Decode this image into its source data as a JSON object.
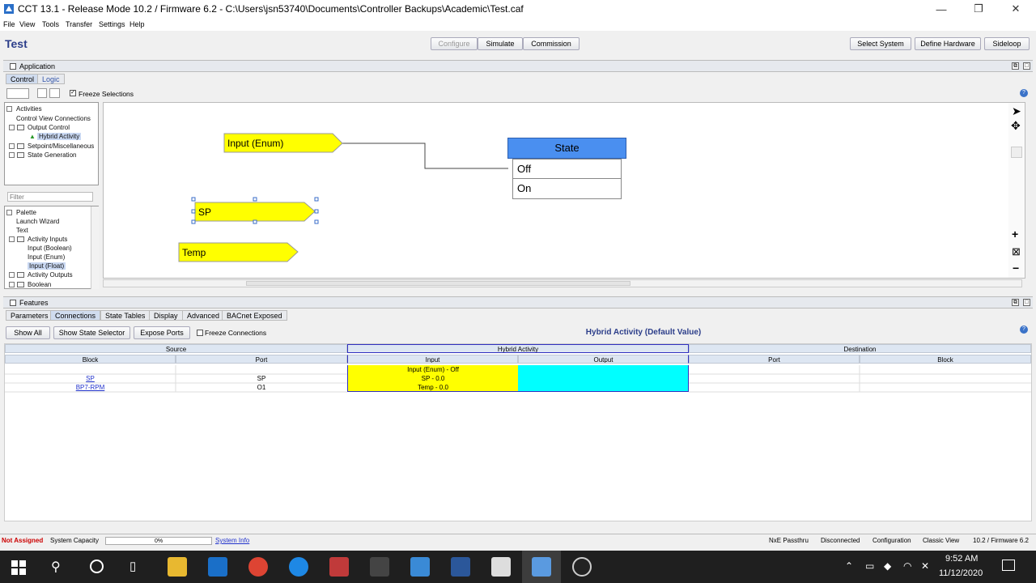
{
  "window": {
    "title": "CCT 13.1 - Release Mode 10.2 / Firmware 6.2 - C:\\Users\\jsn53740\\Documents\\Controller Backups\\Academic\\Test.caf"
  },
  "menu": [
    "File",
    "View",
    "Tools",
    "Transfer",
    "Settings",
    "Help"
  ],
  "header": {
    "title": "Test",
    "mode_buttons": [
      "Configure",
      "Simulate",
      "Commission"
    ],
    "right_buttons": [
      "Select System",
      "Define Hardware",
      "Sideloop"
    ]
  },
  "application": {
    "panel_title": "Application",
    "tabs": [
      "Control",
      "Logic"
    ],
    "freeze_label": "Freeze Selections",
    "tree": [
      "Activities",
      "Control View Connections",
      "Output Control",
      "Hybrid Activity",
      "Setpoint/Miscellaneous",
      "State Generation"
    ],
    "filter_placeholder": "Filter",
    "palette": [
      "Palette",
      "Launch Wizard",
      "Text",
      "Activity Inputs",
      "Input (Boolean)",
      "Input (Enum)",
      "Input (Float)",
      "Activity Outputs",
      "Boolean"
    ]
  },
  "canvas": {
    "blocks": {
      "input_enum": "Input (Enum)",
      "sp": "SP",
      "temp": "Temp"
    },
    "state": {
      "header": "State",
      "rows": [
        "Off",
        "On"
      ]
    }
  },
  "features": {
    "panel_title": "Features",
    "tabs": [
      "Parameters",
      "Connections",
      "State Tables",
      "Display",
      "Advanced",
      "BACnet Exposed"
    ],
    "buttons": [
      "Show All",
      "Show State Selector",
      "Expose Ports"
    ],
    "freeze_label": "Freeze Connections",
    "heading": "Hybrid Activity (Default Value)",
    "table": {
      "groups": [
        "Source",
        "Hybrid Activity",
        "Destination"
      ],
      "columns": [
        "Block",
        "Port",
        "Input",
        "Output",
        "Port",
        "Block"
      ],
      "rows": [
        {
          "block": "",
          "port": "",
          "input": "Input (Enum) - Off"
        },
        {
          "block": "SP",
          "port": "SP",
          "input": "SP - 0.0"
        },
        {
          "block": "BP7-RPM",
          "port": "O1",
          "input": "Temp - 0.0"
        }
      ]
    }
  },
  "status": {
    "assigned": "Not Assigned",
    "capacity_label": "System Capacity",
    "capacity_value": "0%",
    "info_link": "System Info",
    "right": [
      "NxE Passthru",
      "Disconnected",
      "Configuration",
      "Classic View",
      "10.2 / Firmware 6.2"
    ]
  },
  "taskbar": {
    "time": "9:52 AM",
    "date": "11/12/2020"
  },
  "colors": {
    "yellow": "#ffff00",
    "cyan": "#00ffff",
    "state_blue": "#4a8ff0",
    "title_blue": "#2c3e8a"
  }
}
